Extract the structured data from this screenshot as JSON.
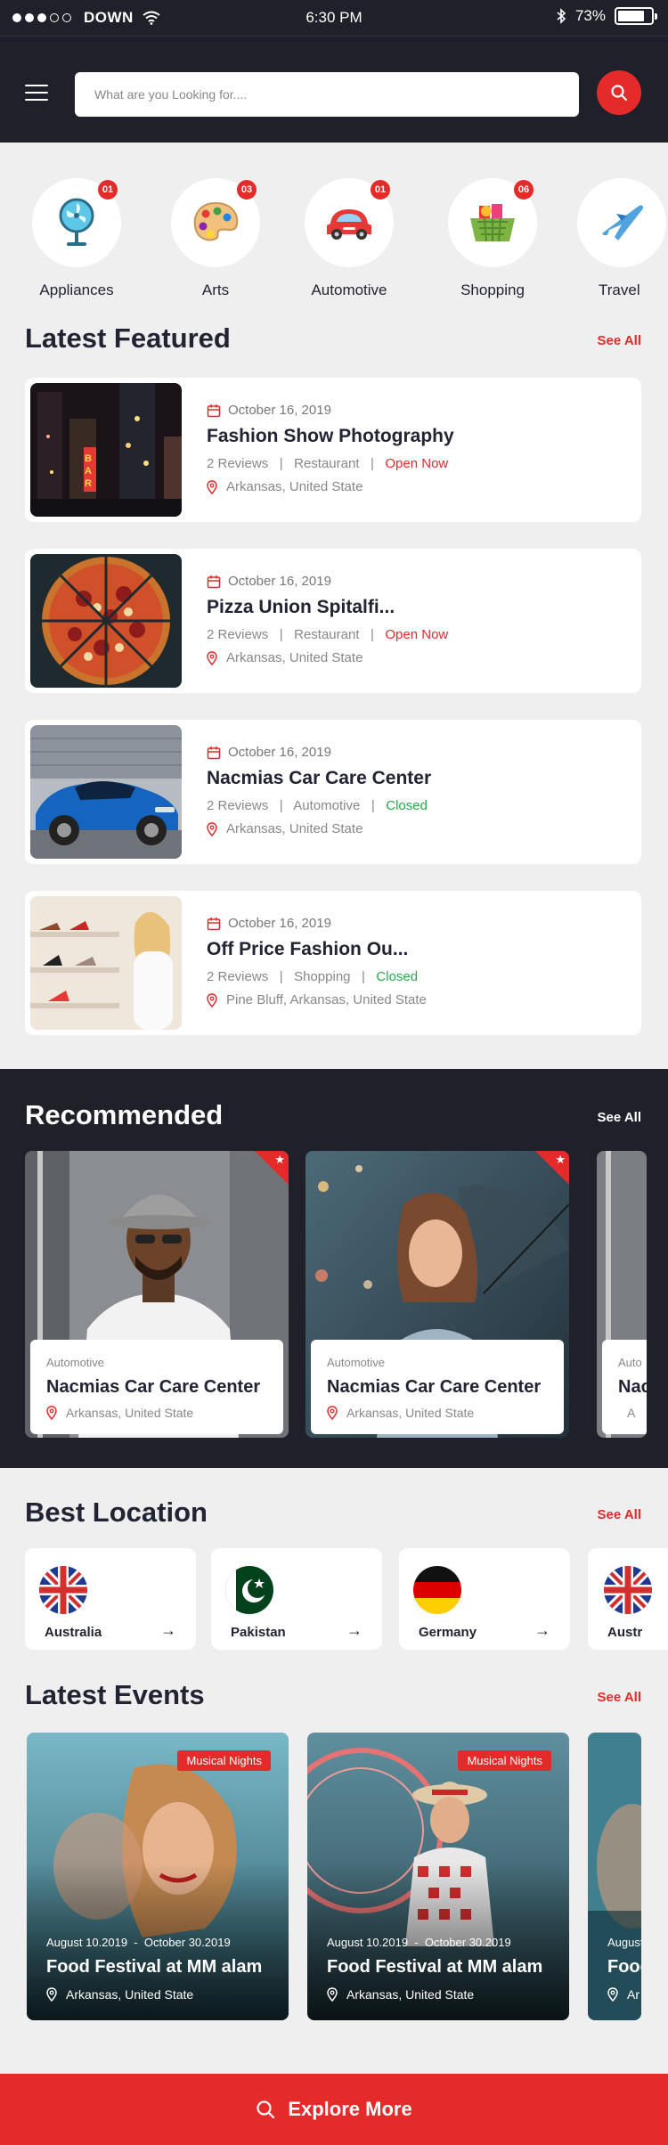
{
  "status": {
    "carrier": "DOWN",
    "time": "6:30 PM",
    "battery": "73%"
  },
  "search": {
    "placeholder": "What are you Looking for...."
  },
  "categories": [
    {
      "label": "Appliances",
      "count": "01",
      "icon": "fan-icon"
    },
    {
      "label": "Arts",
      "count": "03",
      "icon": "palette-icon"
    },
    {
      "label": "Automotive",
      "count": "01",
      "icon": "car-icon"
    },
    {
      "label": "Shopping",
      "count": "06",
      "icon": "basket-icon"
    },
    {
      "label": "Travel",
      "count": "",
      "icon": "airplane-icon"
    }
  ],
  "featured": {
    "title": "Latest Featured",
    "see_all": "See All",
    "items": [
      {
        "date": "October 16, 2019",
        "title": "Fashion Show Photography",
        "reviews": "2 Reviews",
        "category": "Restaurant",
        "status": "Open Now",
        "location": "Arkansas, United State"
      },
      {
        "date": "October 16, 2019",
        "title": "Pizza Union Spitalfi...",
        "reviews": "2 Reviews",
        "category": "Restaurant",
        "status": "Open Now",
        "location": "Arkansas, United State"
      },
      {
        "date": "October 16, 2019",
        "title": "Nacmias Car Care Center",
        "reviews": "2 Reviews",
        "category": "Automotive",
        "status": "Closed",
        "location": "Arkansas, United State"
      },
      {
        "date": "October 16, 2019",
        "title": "Off Price Fashion Ou...",
        "reviews": "2 Reviews",
        "category": "Shopping",
        "status": "Closed",
        "location": "Pine Bluff, Arkansas, United State"
      }
    ]
  },
  "recommended": {
    "title": "Recommended",
    "see_all": "See All",
    "items": [
      {
        "category": "Automotive",
        "title": "Nacmias Car Care Center",
        "location": "Arkansas, United State"
      },
      {
        "category": "Automotive",
        "title": "Nacmias Car Care Center",
        "location": "Arkansas, United State"
      },
      {
        "category": "Auto",
        "title": "Nac",
        "location": "A"
      }
    ]
  },
  "locations": {
    "title": "Best Location",
    "see_all": "See All",
    "items": [
      {
        "name": "Australia",
        "flag": "uk-flag"
      },
      {
        "name": "Pakistan",
        "flag": "pakistan-flag"
      },
      {
        "name": "Germany",
        "flag": "germany-flag"
      },
      {
        "name": "Austr",
        "flag": "uk-flag"
      }
    ]
  },
  "events": {
    "title": "Latest Events",
    "see_all": "See All",
    "items": [
      {
        "tag": "Musical Nights",
        "dates": "August 10.2019  -  October 30.2019",
        "title": "Food Festival at MM alam",
        "location": "Arkansas, United State"
      },
      {
        "tag": "Musical Nights",
        "dates": "August 10.2019  -  October 30.2019",
        "title": "Food Festival at MM alam",
        "location": "Arkansas, United State"
      },
      {
        "tag": "",
        "dates": "August",
        "title": "Food",
        "location": "Ar"
      }
    ]
  },
  "explore": {
    "label": "Explore More"
  },
  "colors": {
    "accent": "#e52a2a",
    "dark": "#1f2029",
    "background": "#efefef",
    "open": "#e52a2a",
    "closed": "#2aa84a"
  }
}
